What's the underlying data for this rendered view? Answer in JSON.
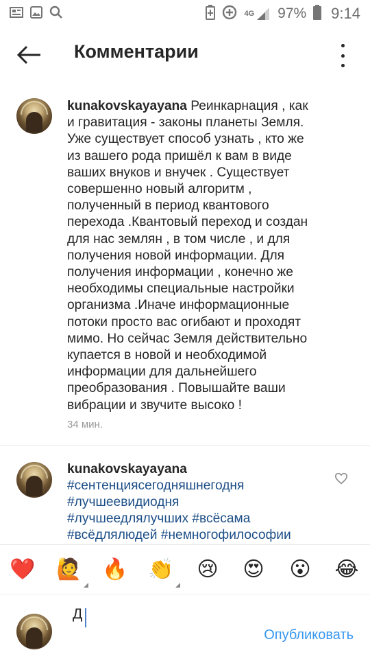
{
  "status_bar": {
    "battery_percent": "97%",
    "time": "9:14",
    "network": "4G",
    "icons": [
      "news-icon",
      "image-icon",
      "search-icon",
      "battery-saver-icon",
      "data-saver-icon",
      "signal-icon",
      "battery-icon"
    ]
  },
  "header": {
    "title": "Комментарии",
    "back_icon": "arrow-left-icon",
    "more_icon": "more-vertical-icon"
  },
  "comments": [
    {
      "username": "kunakovskayayana",
      "lines": [
        "Реинкарнация , как",
        "и гравитация -  законы планеты Земля.",
        "Уже существует способ узнать , кто же",
        "из вашего рода пришёл к вам в виде",
        "ваших внуков и внучек . Существует",
        "совершенно новый алгоритм ,",
        "полученный в период квантового",
        "перехода .Квантовый переход и создан",
        "для нас землян , в том числе , и для",
        "получения новой информации. Для",
        "получения информации , конечно же",
        "необходимы специальные настройки",
        "организма .Иначе информационные",
        "потоки просто вас огибают и проходят",
        "мимо. Но сейчас Земля действительно",
        "купается в новой и необходимой",
        "информации для дальнейшего",
        "преобразования . Повышайте ваши",
        "вибрации и звучите высоко !"
      ],
      "time": "34 мин."
    },
    {
      "username": "kunakovskayayana",
      "hashtags": [
        "#сентенциясегодняшнегодня",
        "#лучшеевидиодня",
        "#лучшеедлялучших #всёсама",
        "#всёдлялюдей #немногофилософии"
      ],
      "like_icon": "heart-outline-icon"
    }
  ],
  "emoji_bar": [
    "❤️",
    "🙋",
    "🔥",
    "👏",
    "😢",
    "😍",
    "😮",
    "😂"
  ],
  "composer": {
    "value": "Д",
    "publish_label": "Опубликовать"
  },
  "colors": {
    "link": "#1c4e87",
    "publish": "#3897f0"
  }
}
